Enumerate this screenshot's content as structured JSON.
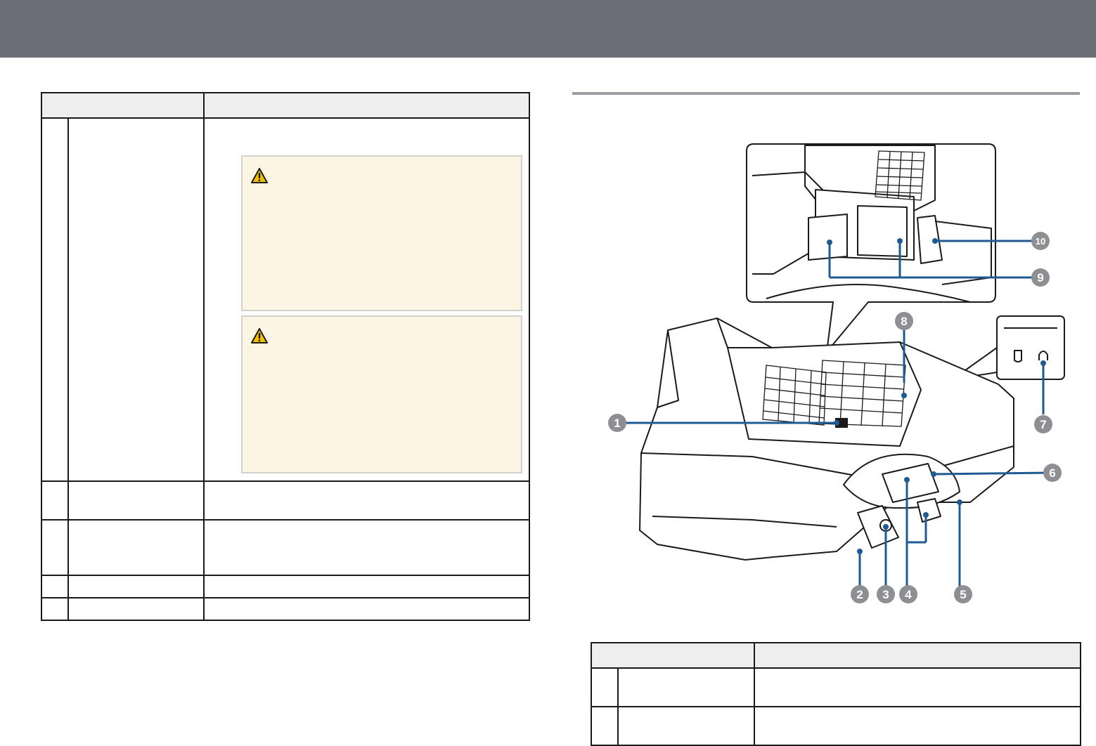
{
  "header": {
    "band_color": "#6b6e76"
  },
  "left_table": {
    "rows": [
      {
        "number": "",
        "name": "",
        "warnings": [
          "caution-warning",
          "caution-warning"
        ]
      },
      {
        "number": "",
        "name": "",
        "description": ""
      },
      {
        "number": "",
        "name": "",
        "description": ""
      },
      {
        "number": "",
        "name": "",
        "description": ""
      },
      {
        "number": "",
        "name": "",
        "description": ""
      }
    ]
  },
  "figure": {
    "callouts": [
      "1",
      "2",
      "3",
      "4",
      "5",
      "6",
      "7",
      "8",
      "9",
      "10"
    ],
    "accent_color": "#1f5a93"
  },
  "right_table": {
    "rows": [
      {
        "number": "",
        "name": "",
        "description": ""
      },
      {
        "number": "",
        "name": "",
        "description": ""
      }
    ]
  }
}
